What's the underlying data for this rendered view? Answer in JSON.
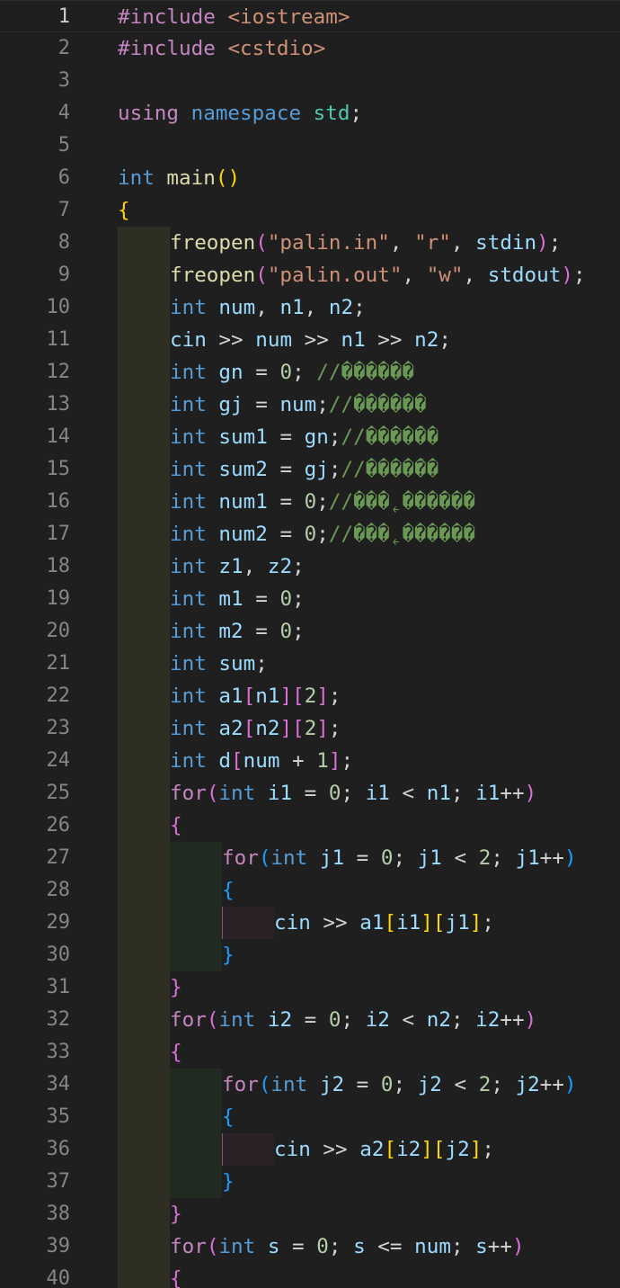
{
  "editor": {
    "language": "cpp",
    "colors": {
      "background": "#1f1f1f",
      "line_number": "#858585",
      "active_line_number": "#cccccc",
      "keyword": "#569cd6",
      "control": "#c586c0",
      "function": "#dcdcaa",
      "variable": "#9cdcfe",
      "string": "#ce9178",
      "number": "#b5cea8",
      "comment": "#6a9955",
      "namespace": "#4ec9b0"
    },
    "active_line": 1,
    "lines": [
      {
        "n": 1,
        "indent": 0,
        "text": "#include <iostream>",
        "tokens": [
          [
            "pp",
            "#include "
          ],
          [
            "str",
            "<iostream>"
          ]
        ]
      },
      {
        "n": 2,
        "indent": 0,
        "text": "#include <cstdio>",
        "tokens": [
          [
            "pp",
            "#include "
          ],
          [
            "str",
            "<cstdio>"
          ]
        ]
      },
      {
        "n": 3,
        "indent": 0,
        "text": "",
        "tokens": []
      },
      {
        "n": 4,
        "indent": 0,
        "text": "using namespace std;",
        "tokens": [
          [
            "cf",
            "using "
          ],
          [
            "kw",
            "namespace "
          ],
          [
            "ns",
            "std"
          ],
          [
            "op",
            ";"
          ]
        ]
      },
      {
        "n": 5,
        "indent": 0,
        "text": "",
        "tokens": []
      },
      {
        "n": 6,
        "indent": 0,
        "text": "int main()",
        "tokens": [
          [
            "kw",
            "int "
          ],
          [
            "fn",
            "main"
          ],
          [
            "b1",
            "()"
          ]
        ]
      },
      {
        "n": 7,
        "indent": 0,
        "text": "{",
        "tokens": [
          [
            "b1",
            "{"
          ]
        ]
      },
      {
        "n": 8,
        "indent": 1,
        "text": "freopen(\"palin.in\", \"r\", stdin);",
        "tokens": [
          [
            "fn",
            "freopen"
          ],
          [
            "b2",
            "("
          ],
          [
            "str",
            "\"palin.in\""
          ],
          [
            "op",
            ", "
          ],
          [
            "str",
            "\"r\""
          ],
          [
            "op",
            ", "
          ],
          [
            "var",
            "stdin"
          ],
          [
            "b2",
            ")"
          ],
          [
            "op",
            ";"
          ]
        ]
      },
      {
        "n": 9,
        "indent": 1,
        "text": "freopen(\"palin.out\", \"w\", stdout);",
        "tokens": [
          [
            "fn",
            "freopen"
          ],
          [
            "b2",
            "("
          ],
          [
            "str",
            "\"palin.out\""
          ],
          [
            "op",
            ", "
          ],
          [
            "str",
            "\"w\""
          ],
          [
            "op",
            ", "
          ],
          [
            "var",
            "stdout"
          ],
          [
            "b2",
            ")"
          ],
          [
            "op",
            ";"
          ]
        ]
      },
      {
        "n": 10,
        "indent": 1,
        "text": "int num, n1, n2;",
        "tokens": [
          [
            "kw",
            "int "
          ],
          [
            "var",
            "num"
          ],
          [
            "op",
            ", "
          ],
          [
            "var",
            "n1"
          ],
          [
            "op",
            ", "
          ],
          [
            "var",
            "n2"
          ],
          [
            "op",
            ";"
          ]
        ]
      },
      {
        "n": 11,
        "indent": 1,
        "text": "cin >> num >> n1 >> n2;",
        "tokens": [
          [
            "var",
            "cin"
          ],
          [
            "op",
            " >> "
          ],
          [
            "var",
            "num"
          ],
          [
            "op",
            " >> "
          ],
          [
            "var",
            "n1"
          ],
          [
            "op",
            " >> "
          ],
          [
            "var",
            "n2"
          ],
          [
            "op",
            ";"
          ]
        ]
      },
      {
        "n": 12,
        "indent": 1,
        "text": "int gn = 0; //������",
        "tokens": [
          [
            "kw",
            "int "
          ],
          [
            "var",
            "gn"
          ],
          [
            "op",
            " = "
          ],
          [
            "num",
            "0"
          ],
          [
            "op",
            "; "
          ],
          [
            "cm",
            "//������"
          ]
        ]
      },
      {
        "n": 13,
        "indent": 1,
        "text": "int gj = num;//������",
        "tokens": [
          [
            "kw",
            "int "
          ],
          [
            "var",
            "gj"
          ],
          [
            "op",
            " = "
          ],
          [
            "var",
            "num"
          ],
          [
            "op",
            ";"
          ],
          [
            "cm",
            "//������"
          ]
        ]
      },
      {
        "n": 14,
        "indent": 1,
        "text": "int sum1 = gn;//����ܵ��",
        "tokens": [
          [
            "kw",
            "int "
          ],
          [
            "var",
            "sum1"
          ],
          [
            "op",
            " = "
          ],
          [
            "var",
            "gn"
          ],
          [
            "op",
            ";"
          ],
          [
            "cm",
            "//����ܵ��"
          ]
        ]
      },
      {
        "n": 15,
        "indent": 1,
        "text": "int sum2 = gj;//����ܵ��",
        "tokens": [
          [
            "kw",
            "int "
          ],
          [
            "var",
            "sum2"
          ],
          [
            "op",
            " = "
          ],
          [
            "var",
            "gj"
          ],
          [
            "op",
            ";"
          ],
          [
            "cm",
            "//����ܵ��"
          ]
        ]
      },
      {
        "n": 16,
        "indent": 1,
        "text": "int num1 = 0;//���˿������",
        "tokens": [
          [
            "kw",
            "int "
          ],
          [
            "var",
            "num1"
          ],
          [
            "op",
            " = "
          ],
          [
            "num",
            "0"
          ],
          [
            "op",
            ";"
          ],
          [
            "cm",
            "//���˿������"
          ]
        ]
      },
      {
        "n": 17,
        "indent": 1,
        "text": "int num2 = 0;//���˿������",
        "tokens": [
          [
            "kw",
            "int "
          ],
          [
            "var",
            "num2"
          ],
          [
            "op",
            " = "
          ],
          [
            "num",
            "0"
          ],
          [
            "op",
            ";"
          ],
          [
            "cm",
            "//���˿������"
          ]
        ]
      },
      {
        "n": 18,
        "indent": 1,
        "text": "int z1, z2;",
        "tokens": [
          [
            "kw",
            "int "
          ],
          [
            "var",
            "z1"
          ],
          [
            "op",
            ", "
          ],
          [
            "var",
            "z2"
          ],
          [
            "op",
            ";"
          ]
        ]
      },
      {
        "n": 19,
        "indent": 1,
        "text": "int m1 = 0;",
        "tokens": [
          [
            "kw",
            "int "
          ],
          [
            "var",
            "m1"
          ],
          [
            "op",
            " = "
          ],
          [
            "num",
            "0"
          ],
          [
            "op",
            ";"
          ]
        ]
      },
      {
        "n": 20,
        "indent": 1,
        "text": "int m2 = 0;",
        "tokens": [
          [
            "kw",
            "int "
          ],
          [
            "var",
            "m2"
          ],
          [
            "op",
            " = "
          ],
          [
            "num",
            "0"
          ],
          [
            "op",
            ";"
          ]
        ]
      },
      {
        "n": 21,
        "indent": 1,
        "text": "int sum;",
        "tokens": [
          [
            "kw",
            "int "
          ],
          [
            "var",
            "sum"
          ],
          [
            "op",
            ";"
          ]
        ]
      },
      {
        "n": 22,
        "indent": 1,
        "text": "int a1[n1][2];",
        "tokens": [
          [
            "kw",
            "int "
          ],
          [
            "var",
            "a1"
          ],
          [
            "b2",
            "["
          ],
          [
            "var",
            "n1"
          ],
          [
            "b2",
            "]["
          ],
          [
            "num",
            "2"
          ],
          [
            "b2",
            "]"
          ],
          [
            "op",
            ";"
          ]
        ]
      },
      {
        "n": 23,
        "indent": 1,
        "text": "int a2[n2][2];",
        "tokens": [
          [
            "kw",
            "int "
          ],
          [
            "var",
            "a2"
          ],
          [
            "b2",
            "["
          ],
          [
            "var",
            "n2"
          ],
          [
            "b2",
            "]["
          ],
          [
            "num",
            "2"
          ],
          [
            "b2",
            "]"
          ],
          [
            "op",
            ";"
          ]
        ]
      },
      {
        "n": 24,
        "indent": 1,
        "text": "int d[num + 1];",
        "tokens": [
          [
            "kw",
            "int "
          ],
          [
            "var",
            "d"
          ],
          [
            "b2",
            "["
          ],
          [
            "var",
            "num"
          ],
          [
            "op",
            " + "
          ],
          [
            "num",
            "1"
          ],
          [
            "b2",
            "]"
          ],
          [
            "op",
            ";"
          ]
        ]
      },
      {
        "n": 25,
        "indent": 1,
        "text": "for(int i1 = 0; i1 < n1; i1++)",
        "tokens": [
          [
            "cf",
            "for"
          ],
          [
            "b2",
            "("
          ],
          [
            "kw",
            "int "
          ],
          [
            "var",
            "i1"
          ],
          [
            "op",
            " = "
          ],
          [
            "num",
            "0"
          ],
          [
            "op",
            "; "
          ],
          [
            "var",
            "i1"
          ],
          [
            "op",
            " < "
          ],
          [
            "var",
            "n1"
          ],
          [
            "op",
            "; "
          ],
          [
            "var",
            "i1"
          ],
          [
            "op",
            "++"
          ],
          [
            "b2",
            ")"
          ]
        ]
      },
      {
        "n": 26,
        "indent": 1,
        "text": "{",
        "tokens": [
          [
            "b2",
            "{"
          ]
        ]
      },
      {
        "n": 27,
        "indent": 2,
        "text": "for(int j1 = 0; j1 < 2; j1++)",
        "tokens": [
          [
            "cf",
            "for"
          ],
          [
            "b3",
            "("
          ],
          [
            "kw",
            "int "
          ],
          [
            "var",
            "j1"
          ],
          [
            "op",
            " = "
          ],
          [
            "num",
            "0"
          ],
          [
            "op",
            "; "
          ],
          [
            "var",
            "j1"
          ],
          [
            "op",
            " < "
          ],
          [
            "num",
            "2"
          ],
          [
            "op",
            "; "
          ],
          [
            "var",
            "j1"
          ],
          [
            "op",
            "++"
          ],
          [
            "b3",
            ")"
          ]
        ]
      },
      {
        "n": 28,
        "indent": 2,
        "text": "{",
        "tokens": [
          [
            "b3",
            "{"
          ]
        ]
      },
      {
        "n": 29,
        "indent": 3,
        "text": "cin >> a1[i1][j1];",
        "tokens": [
          [
            "var",
            "cin"
          ],
          [
            "op",
            " >> "
          ],
          [
            "var",
            "a1"
          ],
          [
            "b1",
            "["
          ],
          [
            "var",
            "i1"
          ],
          [
            "b1",
            "]["
          ],
          [
            "var",
            "j1"
          ],
          [
            "b1",
            "]"
          ],
          [
            "op",
            ";"
          ]
        ]
      },
      {
        "n": 30,
        "indent": 2,
        "text": "}",
        "tokens": [
          [
            "b3",
            "}"
          ]
        ]
      },
      {
        "n": 31,
        "indent": 1,
        "text": "}",
        "tokens": [
          [
            "b2",
            "}"
          ]
        ]
      },
      {
        "n": 32,
        "indent": 1,
        "text": "for(int i2 = 0; i2 < n2; i2++)",
        "tokens": [
          [
            "cf",
            "for"
          ],
          [
            "b2",
            "("
          ],
          [
            "kw",
            "int "
          ],
          [
            "var",
            "i2"
          ],
          [
            "op",
            " = "
          ],
          [
            "num",
            "0"
          ],
          [
            "op",
            "; "
          ],
          [
            "var",
            "i2"
          ],
          [
            "op",
            " < "
          ],
          [
            "var",
            "n2"
          ],
          [
            "op",
            "; "
          ],
          [
            "var",
            "i2"
          ],
          [
            "op",
            "++"
          ],
          [
            "b2",
            ")"
          ]
        ]
      },
      {
        "n": 33,
        "indent": 1,
        "text": "{",
        "tokens": [
          [
            "b2",
            "{"
          ]
        ]
      },
      {
        "n": 34,
        "indent": 2,
        "text": "for(int j2 = 0; j2 < 2; j2++)",
        "tokens": [
          [
            "cf",
            "for"
          ],
          [
            "b3",
            "("
          ],
          [
            "kw",
            "int "
          ],
          [
            "var",
            "j2"
          ],
          [
            "op",
            " = "
          ],
          [
            "num",
            "0"
          ],
          [
            "op",
            "; "
          ],
          [
            "var",
            "j2"
          ],
          [
            "op",
            " < "
          ],
          [
            "num",
            "2"
          ],
          [
            "op",
            "; "
          ],
          [
            "var",
            "j2"
          ],
          [
            "op",
            "++"
          ],
          [
            "b3",
            ")"
          ]
        ]
      },
      {
        "n": 35,
        "indent": 2,
        "text": "{",
        "tokens": [
          [
            "b3",
            "{"
          ]
        ]
      },
      {
        "n": 36,
        "indent": 3,
        "text": "cin >> a2[i2][j2];",
        "tokens": [
          [
            "var",
            "cin"
          ],
          [
            "op",
            " >> "
          ],
          [
            "var",
            "a2"
          ],
          [
            "b1",
            "["
          ],
          [
            "var",
            "i2"
          ],
          [
            "b1",
            "]["
          ],
          [
            "var",
            "j2"
          ],
          [
            "b1",
            "]"
          ],
          [
            "op",
            ";"
          ]
        ]
      },
      {
        "n": 37,
        "indent": 2,
        "text": "}",
        "tokens": [
          [
            "b3",
            "}"
          ]
        ]
      },
      {
        "n": 38,
        "indent": 1,
        "text": "}",
        "tokens": [
          [
            "b2",
            "}"
          ]
        ]
      },
      {
        "n": 39,
        "indent": 1,
        "text": "for(int s = 0; s <= num; s++)",
        "tokens": [
          [
            "cf",
            "for"
          ],
          [
            "b2",
            "("
          ],
          [
            "kw",
            "int "
          ],
          [
            "var",
            "s"
          ],
          [
            "op",
            " = "
          ],
          [
            "num",
            "0"
          ],
          [
            "op",
            "; "
          ],
          [
            "var",
            "s"
          ],
          [
            "op",
            " <= "
          ],
          [
            "var",
            "num"
          ],
          [
            "op",
            "; "
          ],
          [
            "var",
            "s"
          ],
          [
            "op",
            "++"
          ],
          [
            "b2",
            ")"
          ]
        ]
      },
      {
        "n": 40,
        "indent": 1,
        "text": "{",
        "tokens": [
          [
            "b2",
            "{"
          ]
        ]
      }
    ]
  }
}
